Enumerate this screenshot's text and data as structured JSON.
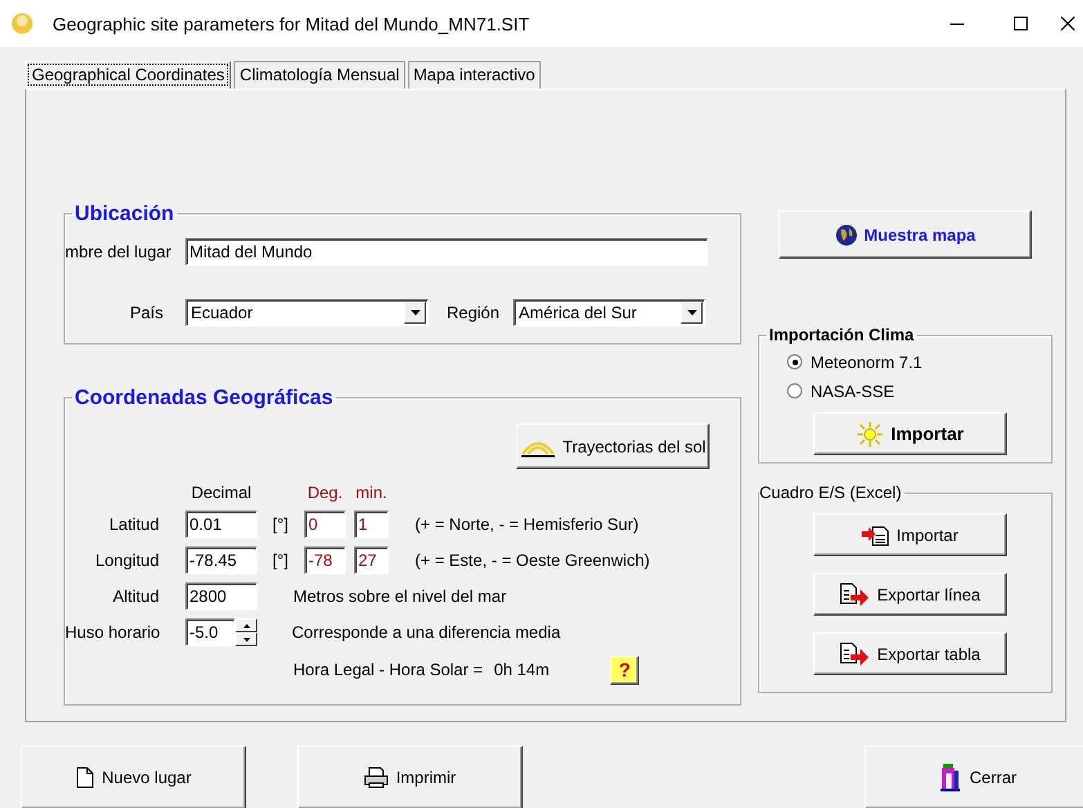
{
  "window": {
    "title": "Geographic site parameters for Mitad del Mundo_MN71.SIT"
  },
  "tabs": [
    {
      "label": "Geographical Coordinates",
      "selected": true
    },
    {
      "label": "Climatología Mensual",
      "selected": false
    },
    {
      "label": "Mapa interactivo",
      "selected": false
    }
  ],
  "location": {
    "title": "Ubicación",
    "name_label": "mbre del lugar",
    "name_value": "Mitad del Mundo",
    "country_label": "País",
    "country_value": "Ecuador",
    "region_label": "Región",
    "region_value": "América del Sur"
  },
  "coordinates": {
    "title": "Coordenadas Geográficas",
    "sun_paths_button": "Trayectorias del sol",
    "decimal_header": "Decimal",
    "deg_header": "Deg.",
    "min_header": "min.",
    "rows": [
      {
        "kind": "angle",
        "label": "Latitud",
        "value": "0.01",
        "unit": "[°]",
        "deg": "0",
        "min": "1",
        "note": "(+ = Norte, - = Hemisferio Sur)"
      },
      {
        "kind": "angle",
        "label": "Longitud",
        "value": "-78.45",
        "unit": "[°]",
        "deg": "-78",
        "min": "27",
        "note": "(+ = Este, - = Oeste Greenwich)"
      },
      {
        "kind": "plain",
        "label": "Altitud",
        "value": "2800",
        "note": "Metros sobre el nivel del mar"
      },
      {
        "kind": "spin",
        "label": "Huso horario",
        "value": "-5.0",
        "note": "Corresponde a una diferencia media"
      }
    ],
    "solar_time_label": "Hora Legal - Hora Solar =",
    "solar_time_value": "0h 14m",
    "help_button": "?"
  },
  "show_map_button": "Muestra mapa",
  "climate_import": {
    "title": "Importación Clima",
    "options": [
      {
        "label": "Meteonorm 7.1",
        "selected": true
      },
      {
        "label": "NASA-SSE",
        "selected": false
      }
    ],
    "import_button": "Importar"
  },
  "excel_io": {
    "title": "Cuadro E/S (Excel)",
    "buttons": [
      {
        "kind": "import",
        "label": "Importar"
      },
      {
        "kind": "export",
        "label": "Exportar línea"
      },
      {
        "kind": "export",
        "label": "Exportar tabla"
      }
    ]
  },
  "footer_buttons": [
    {
      "kind": "new",
      "label": "Nuevo lugar"
    },
    {
      "kind": "print",
      "label": "Imprimir"
    },
    {
      "kind": "close",
      "label": "Cerrar"
    }
  ]
}
